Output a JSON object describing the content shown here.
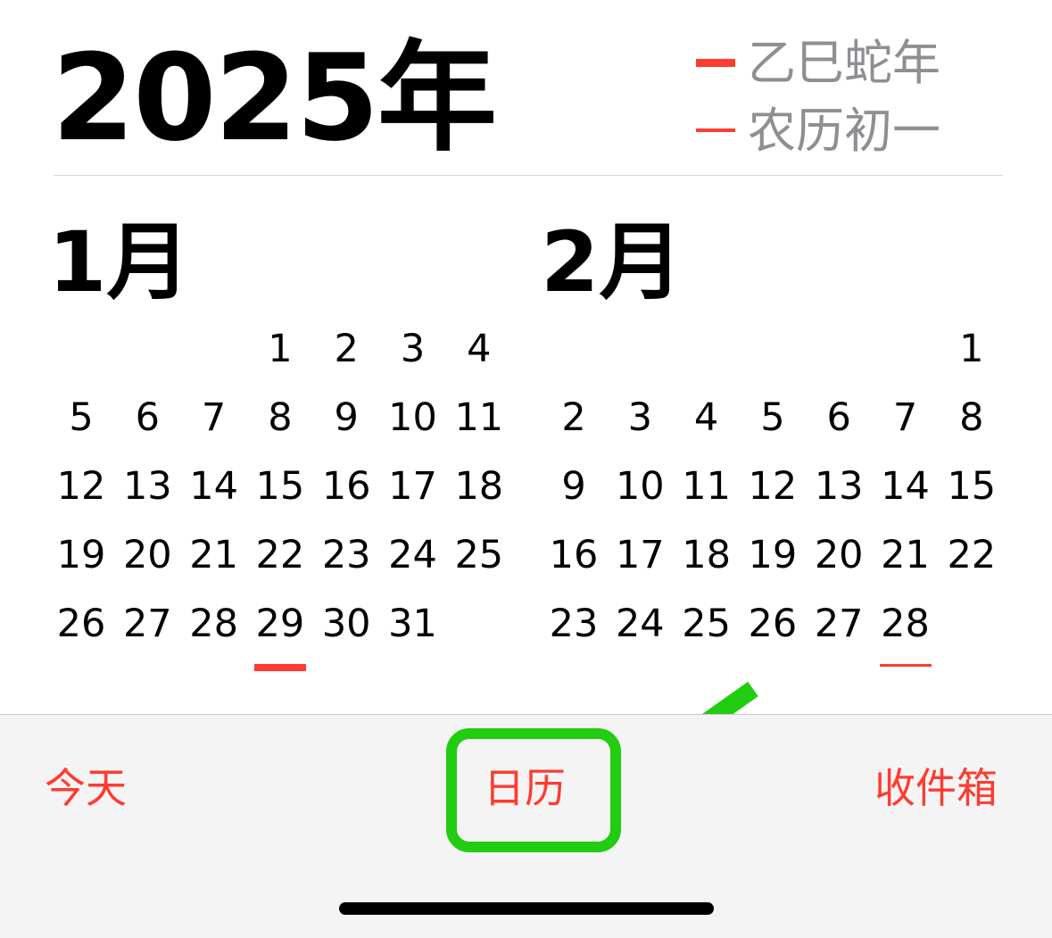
{
  "year": {
    "title": "2025年"
  },
  "legend": {
    "line1": "乙巳蛇年",
    "line2": "农历初一",
    "mark_color": "#ff3b30"
  },
  "months": [
    {
      "title": "1月",
      "first_weekday": 3,
      "days": 31,
      "underlined_day": 29,
      "underline_style": "thick"
    },
    {
      "title": "2月",
      "first_weekday": 6,
      "days": 28,
      "underlined_day": 28,
      "underline_style": "thin"
    }
  ],
  "toolbar": {
    "today_label": "今天",
    "calendar_label": "日历",
    "inbox_label": "收件箱",
    "accent_color": "#ff3b30",
    "highlight_color": "#22cc11"
  }
}
